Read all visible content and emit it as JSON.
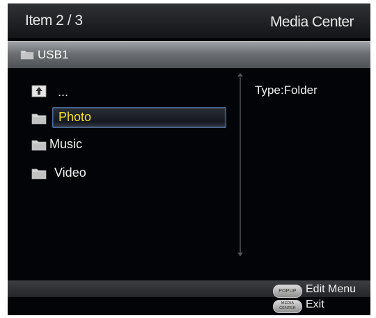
{
  "header": {
    "item_counter": "Item 2 / 3",
    "title": "Media Center"
  },
  "path": {
    "label": "USB1",
    "icon": "folder-icon"
  },
  "list": {
    "items": [
      {
        "label": "...",
        "icon": "folder-up-icon"
      },
      {
        "label": "Photo",
        "icon": "folder-icon",
        "selected": true
      },
      {
        "label": "Music",
        "icon": "folder-icon"
      },
      {
        "label": "Video",
        "icon": "folder-icon"
      }
    ]
  },
  "info": {
    "type_text": "Type:Folder"
  },
  "footer": {
    "hints": [
      {
        "key": "POPUP",
        "label": "Edit Menu"
      },
      {
        "key": "MEDIA CENTER",
        "key_line1": "MEDIA",
        "key_line2": "CENTER",
        "label": "Exit"
      }
    ]
  },
  "colors": {
    "selected_text": "#f7e12a",
    "highlight_border": "#4a6a9a",
    "background": "#030408"
  }
}
